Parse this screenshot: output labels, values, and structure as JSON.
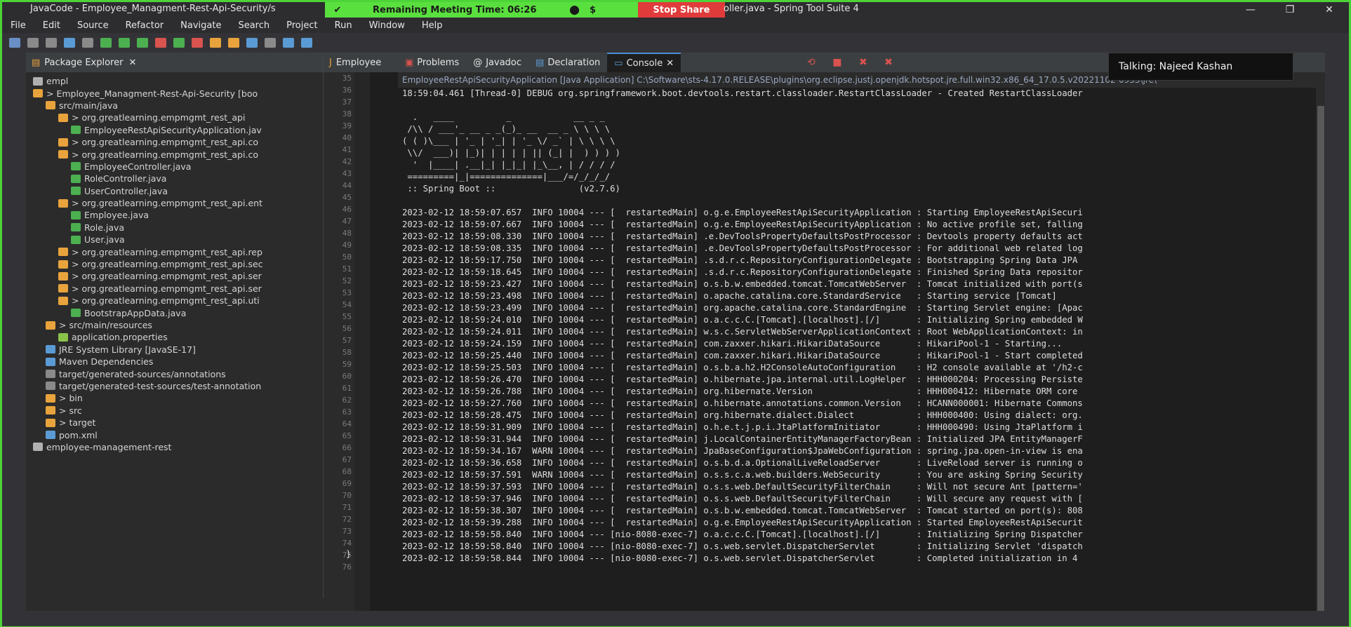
{
  "window": {
    "title_left": "JavaCode - Employee_Managment-Rest-Api-Security/s",
    "title_right": "oller.java - Spring Tool Suite 4",
    "minimize": "—",
    "restore": "❐",
    "close": "✕"
  },
  "zoom": {
    "remaining": "Remaining Meeting Time: 06:26",
    "stop_share": "Stop Share"
  },
  "menu": [
    "File",
    "Edit",
    "Source",
    "Refactor",
    "Navigate",
    "Search",
    "Project",
    "Run",
    "Window",
    "Help"
  ],
  "package_explorer": {
    "tab_label": "Package Explorer",
    "items": [
      {
        "label": "empl",
        "indent": 0
      },
      {
        "label": "> Employee_Managment-Rest-Api-Security [boo",
        "indent": 0
      },
      {
        "label": "src/main/java",
        "indent": 1
      },
      {
        "label": "> org.greatlearning.empmgmt_rest_api",
        "indent": 2
      },
      {
        "label": "EmployeeRestApiSecurityApplication.jav",
        "indent": 3
      },
      {
        "label": "> org.greatlearning.empmgmt_rest_api.co",
        "indent": 2
      },
      {
        "label": "> org.greatlearning.empmgmt_rest_api.co",
        "indent": 2
      },
      {
        "label": "EmployeeController.java",
        "indent": 3
      },
      {
        "label": "RoleController.java",
        "indent": 3
      },
      {
        "label": "UserController.java",
        "indent": 3
      },
      {
        "label": "> org.greatlearning.empmgmt_rest_api.ent",
        "indent": 2
      },
      {
        "label": "Employee.java",
        "indent": 3
      },
      {
        "label": "Role.java",
        "indent": 3
      },
      {
        "label": "User.java",
        "indent": 3
      },
      {
        "label": "> org.greatlearning.empmgmt_rest_api.rep",
        "indent": 2
      },
      {
        "label": "> org.greatlearning.empmgmt_rest_api.sec",
        "indent": 2
      },
      {
        "label": "> org.greatlearning.empmgmt_rest_api.ser",
        "indent": 2
      },
      {
        "label": "> org.greatlearning.empmgmt_rest_api.ser",
        "indent": 2
      },
      {
        "label": "> org.greatlearning.empmgmt_rest_api.uti",
        "indent": 2
      },
      {
        "label": "BootstrapAppData.java",
        "indent": 3
      },
      {
        "label": "> src/main/resources",
        "indent": 1
      },
      {
        "label": "application.properties",
        "indent": 2
      },
      {
        "label": "JRE System Library [JavaSE-17]",
        "indent": 1
      },
      {
        "label": "Maven Dependencies",
        "indent": 1
      },
      {
        "label": "target/generated-sources/annotations",
        "indent": 1
      },
      {
        "label": "target/generated-test-sources/test-annotation",
        "indent": 1
      },
      {
        "label": "> bin",
        "indent": 1
      },
      {
        "label": "> src",
        "indent": 1
      },
      {
        "label": "> target",
        "indent": 1
      },
      {
        "label": "pom.xml",
        "indent": 1
      },
      {
        "label": "employee-management-rest",
        "indent": 0
      }
    ]
  },
  "editor": {
    "tab_label": "Employee",
    "line_numbers": [
      "35",
      "36",
      "37",
      "38",
      "39",
      "40",
      "41",
      "42",
      "43",
      "44",
      "45",
      "46",
      "47",
      "48",
      "49",
      "50",
      "51",
      "52",
      "53",
      "54",
      "55",
      "56",
      "57",
      "58",
      "59",
      "60",
      "61",
      "62",
      "63",
      "64",
      "65",
      "66",
      "67",
      "68",
      "69",
      "70",
      "71",
      "72",
      "73",
      "74",
      "75",
      "76"
    ],
    "last_brace": "}"
  },
  "console": {
    "tabs": [
      "Problems",
      "Javadoc",
      "Declaration",
      "Console"
    ],
    "info": "EmployeeRestApiSecurityApplication [Java Application] C:\\Software\\sts-4.17.0.RELEASE\\plugins\\org.eclipse.justj.openjdk.hotspot.jre.full.win32.x86_64_17.0.5.v20221102-0933\\jre\\",
    "lines": [
      "18:59:04.461 [Thread-0] DEBUG org.springframework.boot.devtools.restart.classloader.RestartClassLoader - Created RestartClassLoader",
      "",
      "  .   ____          _            __ _ _",
      " /\\\\ / ___'_ __ _ _(_)_ __  __ _ \\ \\ \\ \\",
      "( ( )\\___ | '_ | '_| | '_ \\/ _` | \\ \\ \\ \\",
      " \\\\/  ___)| |_)| | | | | || (_| |  ) ) ) )",
      "  '  |____| .__|_| |_|_| |_\\__, | / / / /",
      " =========|_|==============|___/=/_/_/_/",
      " :: Spring Boot ::                (v2.7.6)",
      "",
      "2023-02-12 18:59:07.657  INFO 10004 --- [  restartedMain] o.g.e.EmployeeRestApiSecurityApplication : Starting EmployeeRestApiSecuri",
      "2023-02-12 18:59:07.667  INFO 10004 --- [  restartedMain] o.g.e.EmployeeRestApiSecurityApplication : No active profile set, falling",
      "2023-02-12 18:59:08.330  INFO 10004 --- [  restartedMain] .e.DevToolsPropertyDefaultsPostProcessor : Devtools property defaults act",
      "2023-02-12 18:59:08.335  INFO 10004 --- [  restartedMain] .e.DevToolsPropertyDefaultsPostProcessor : For additional web related log",
      "2023-02-12 18:59:17.750  INFO 10004 --- [  restartedMain] .s.d.r.c.RepositoryConfigurationDelegate : Bootstrapping Spring Data JPA",
      "2023-02-12 18:59:18.645  INFO 10004 --- [  restartedMain] .s.d.r.c.RepositoryConfigurationDelegate : Finished Spring Data repositor",
      "2023-02-12 18:59:23.427  INFO 10004 --- [  restartedMain] o.s.b.w.embedded.tomcat.TomcatWebServer  : Tomcat initialized with port(s",
      "2023-02-12 18:59:23.498  INFO 10004 --- [  restartedMain] o.apache.catalina.core.StandardService   : Starting service [Tomcat]",
      "2023-02-12 18:59:23.499  INFO 10004 --- [  restartedMain] org.apache.catalina.core.StandardEngine  : Starting Servlet engine: [Apac",
      "2023-02-12 18:59:24.010  INFO 10004 --- [  restartedMain] o.a.c.c.C.[Tomcat].[localhost].[/]       : Initializing Spring embedded W",
      "2023-02-12 18:59:24.011  INFO 10004 --- [  restartedMain] w.s.c.ServletWebServerApplicationContext : Root WebApplicationContext: in",
      "2023-02-12 18:59:24.159  INFO 10004 --- [  restartedMain] com.zaxxer.hikari.HikariDataSource       : HikariPool-1 - Starting...",
      "2023-02-12 18:59:25.440  INFO 10004 --- [  restartedMain] com.zaxxer.hikari.HikariDataSource       : HikariPool-1 - Start completed",
      "2023-02-12 18:59:25.503  INFO 10004 --- [  restartedMain] o.s.b.a.h2.H2ConsoleAutoConfiguration    : H2 console available at '/h2-c",
      "2023-02-12 18:59:26.470  INFO 10004 --- [  restartedMain] o.hibernate.jpa.internal.util.LogHelper  : HHH000204: Processing Persiste",
      "2023-02-12 18:59:26.788  INFO 10004 --- [  restartedMain] org.hibernate.Version                    : HHH000412: Hibernate ORM core",
      "2023-02-12 18:59:27.760  INFO 10004 --- [  restartedMain] o.hibernate.annotations.common.Version   : HCANN000001: Hibernate Commons",
      "2023-02-12 18:59:28.475  INFO 10004 --- [  restartedMain] org.hibernate.dialect.Dialect            : HHH000400: Using dialect: org.",
      "2023-02-12 18:59:31.909  INFO 10004 --- [  restartedMain] o.h.e.t.j.p.i.JtaPlatformInitiator       : HHH000490: Using JtaPlatform i",
      "2023-02-12 18:59:31.944  INFO 10004 --- [  restartedMain] j.LocalContainerEntityManagerFactoryBean : Initialized JPA EntityManagerF",
      "2023-02-12 18:59:34.167  WARN 10004 --- [  restartedMain] JpaBaseConfiguration$JpaWebConfiguration : spring.jpa.open-in-view is ena",
      "2023-02-12 18:59:36.658  INFO 10004 --- [  restartedMain] o.s.b.d.a.OptionalLiveReloadServer       : LiveReload server is running o",
      "2023-02-12 18:59:37.591  WARN 10004 --- [  restartedMain] o.s.s.c.a.web.builders.WebSecurity       : You are asking Spring Security",
      "2023-02-12 18:59:37.593  INFO 10004 --- [  restartedMain] o.s.s.web.DefaultSecurityFilterChain     : Will not secure Ant [pattern='",
      "2023-02-12 18:59:37.946  INFO 10004 --- [  restartedMain] o.s.s.web.DefaultSecurityFilterChain     : Will secure any request with [",
      "2023-02-12 18:59:38.307  INFO 10004 --- [  restartedMain] o.s.b.w.embedded.tomcat.TomcatWebServer  : Tomcat started on port(s): 808",
      "2023-02-12 18:59:39.288  INFO 10004 --- [  restartedMain] o.g.e.EmployeeRestApiSecurityApplication : Started EmployeeRestApiSecurit",
      "2023-02-12 18:59:58.840  INFO 10004 --- [nio-8080-exec-7] o.a.c.c.C.[Tomcat].[localhost].[/]       : Initializing Spring Dispatcher",
      "2023-02-12 18:59:58.840  INFO 10004 --- [nio-8080-exec-7] o.s.web.servlet.DispatcherServlet        : Initializing Servlet 'dispatch",
      "2023-02-12 18:59:58.844  INFO 10004 --- [nio-8080-exec-7] o.s.web.servlet.DispatcherServlet        : Completed initialization in 4"
    ]
  },
  "talking": "Talking: Najeed Kashan"
}
